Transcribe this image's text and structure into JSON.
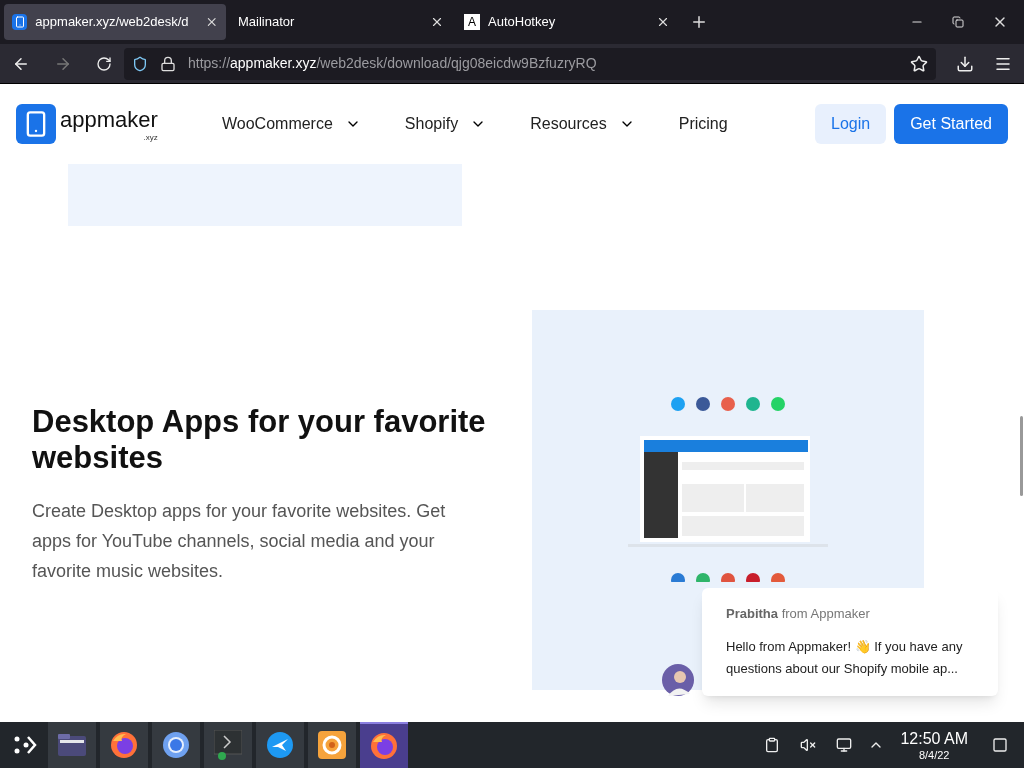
{
  "browser": {
    "tabs": [
      {
        "title": "appmaker.xyz/web2desk/d",
        "selected": true,
        "kind": "phone"
      },
      {
        "title": "Mailinator",
        "selected": false,
        "kind": "plain"
      },
      {
        "title": "AutoHotkey",
        "selected": false,
        "kind": "letter",
        "icon_letter": "A"
      }
    ],
    "url_prefix": "https://",
    "url_host": "appmaker.xyz",
    "url_path": "/web2desk/download/qjg08eicdw9BzfuzryRQ"
  },
  "site": {
    "logo": {
      "name": "appmaker",
      "suffix": ".xyz"
    },
    "nav": [
      {
        "label": "WooCommerce",
        "dropdown": true
      },
      {
        "label": "Shopify",
        "dropdown": true
      },
      {
        "label": "Resources",
        "dropdown": true
      },
      {
        "label": "Pricing",
        "dropdown": false
      }
    ],
    "login": "Login",
    "cta": "Get Started",
    "heading": "Desktop Apps for your favorite websites",
    "body": "Create Desktop apps for your favorite websites. Get apps for YouTube channels, social media and your favorite music websites.",
    "chat": {
      "sender": "Prabitha",
      "from": "from Appmaker",
      "message": "Hello from Appmaker! 👋 If you have any questions about our Shopify mobile ap..."
    }
  },
  "taskbar": {
    "apps": [
      {
        "kind": "folder",
        "selected": false
      },
      {
        "kind": "firefox",
        "selected": false
      },
      {
        "kind": "chromium",
        "selected": false
      },
      {
        "kind": "terminal",
        "selected": false
      },
      {
        "kind": "bird",
        "selected": false
      },
      {
        "kind": "swirl",
        "selected": false
      },
      {
        "kind": "firefox",
        "selected": true
      }
    ],
    "time": "12:50 AM",
    "date": "8/4/22"
  }
}
